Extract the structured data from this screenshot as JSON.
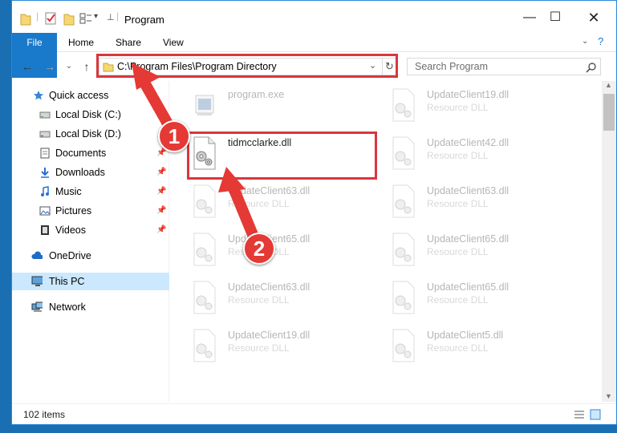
{
  "window": {
    "title": "Program"
  },
  "ribbon": {
    "tabs": [
      "File",
      "Home",
      "Share",
      "View"
    ]
  },
  "address": {
    "path": "C:\\Program Files\\Program Directory"
  },
  "search": {
    "placeholder": "Search Program"
  },
  "sidebar": {
    "items": [
      {
        "label": "Quick access",
        "icon": "star-icon"
      },
      {
        "label": "Local Disk (C:)",
        "icon": "drive-icon"
      },
      {
        "label": "Local Disk (D:)",
        "icon": "drive-icon"
      },
      {
        "label": "Documents",
        "icon": "documents-icon"
      },
      {
        "label": "Downloads",
        "icon": "download-icon"
      },
      {
        "label": "Music",
        "icon": "music-icon"
      },
      {
        "label": "Pictures",
        "icon": "pictures-icon"
      },
      {
        "label": "Videos",
        "icon": "videos-icon"
      },
      {
        "label": "OneDrive",
        "icon": "cloud-icon"
      },
      {
        "label": "This PC",
        "icon": "computer-icon"
      },
      {
        "label": "Network",
        "icon": "network-icon"
      }
    ]
  },
  "files": {
    "left": [
      {
        "name": "program.exe",
        "type": ""
      },
      {
        "name": "tidmcclarke.dll",
        "type": ""
      },
      {
        "name": "UpdateClient63.dll",
        "type": "Resource DLL"
      },
      {
        "name": "UpdateClient65.dll",
        "type": "Resource DLL"
      },
      {
        "name": "UpdateClient63.dll",
        "type": "Resource DLL"
      },
      {
        "name": "UpdateClient19.dll",
        "type": "Resource DLL"
      }
    ],
    "right": [
      {
        "name": "UpdateClient19.dll",
        "type": "Resource DLL"
      },
      {
        "name": "UpdateClient42.dll",
        "type": "Resource DLL"
      },
      {
        "name": "UpdateClient63.dll",
        "type": "Resource DLL"
      },
      {
        "name": "UpdateClient65.dll",
        "type": "Resource DLL"
      },
      {
        "name": "UpdateClient65.dll",
        "type": "Resource DLL"
      },
      {
        "name": "UpdateClient5.dll",
        "type": "Resource DLL"
      }
    ]
  },
  "status": {
    "count": "102 items"
  },
  "annotations": {
    "step1": "1",
    "step2": "2"
  },
  "colors": {
    "accent": "#1979ca",
    "highlight": "#d9363e",
    "selection": "#cce8ff"
  }
}
